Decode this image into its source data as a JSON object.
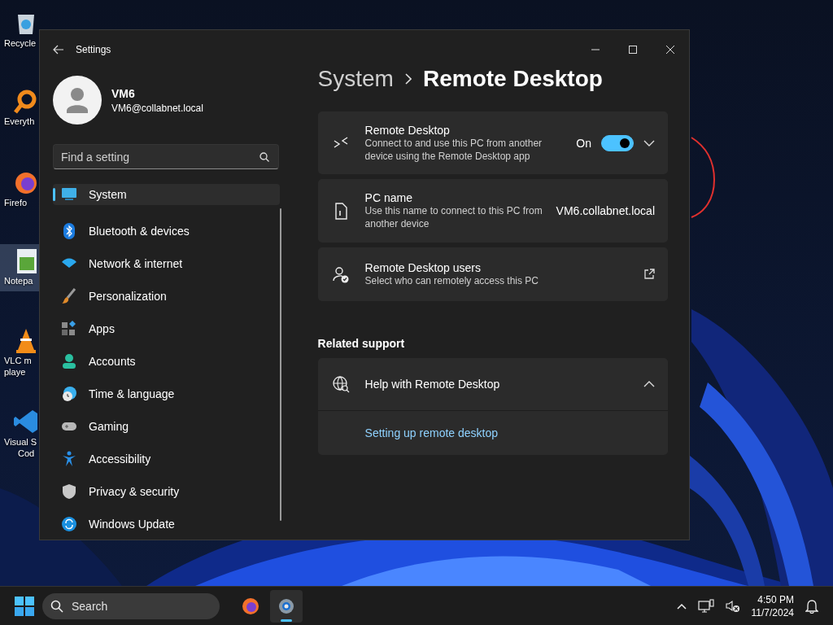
{
  "desktop": {
    "icons": [
      {
        "kind": "recycle",
        "selected": false,
        "lines": [
          "Recycle"
        ]
      },
      {
        "kind": "search",
        "selected": false,
        "lines": [
          "Everyth"
        ]
      },
      {
        "kind": "firefox",
        "selected": false,
        "lines": [
          "Firefo"
        ]
      },
      {
        "kind": "notepad",
        "selected": true,
        "lines": [
          "Notepa"
        ]
      },
      {
        "kind": "vlc",
        "selected": false,
        "lines": [
          "VLC m",
          "playe"
        ]
      },
      {
        "kind": "vscode",
        "selected": false,
        "lines": [
          "Visual S",
          "Cod"
        ]
      }
    ]
  },
  "window": {
    "title": "Settings",
    "profile": {
      "name": "VM6",
      "email": "VM6@collabnet.local"
    },
    "search": {
      "placeholder": "Find a setting"
    },
    "nav": [
      {
        "kind": "system",
        "label": "System",
        "selected": true
      },
      {
        "kind": "bluetooth",
        "label": "Bluetooth & devices",
        "selected": false
      },
      {
        "kind": "network",
        "label": "Network & internet",
        "selected": false
      },
      {
        "kind": "brush",
        "label": "Personalization",
        "selected": false
      },
      {
        "kind": "apps",
        "label": "Apps",
        "selected": false
      },
      {
        "kind": "person",
        "label": "Accounts",
        "selected": false
      },
      {
        "kind": "clock",
        "label": "Time & language",
        "selected": false
      },
      {
        "kind": "gamepad",
        "label": "Gaming",
        "selected": false
      },
      {
        "kind": "figure",
        "label": "Accessibility",
        "selected": false
      },
      {
        "kind": "shield",
        "label": "Privacy & security",
        "selected": false
      },
      {
        "kind": "update",
        "label": "Windows Update",
        "selected": false
      }
    ],
    "breadcrumb": [
      "System",
      "Remote Desktop"
    ],
    "cards": [
      {
        "kind": "toggle",
        "title": "Remote Desktop",
        "description": "Connect to and use this PC from another device using the Remote Desktop app",
        "state_label": "On",
        "on": true,
        "expanded": false
      },
      {
        "kind": "value",
        "title": "PC name",
        "description": "Use this name to connect to this PC from another device",
        "value": "VM6.collabnet.local"
      },
      {
        "kind": "link",
        "title": "Remote Desktop users",
        "description": "Select who can remotely access this PC"
      }
    ],
    "related": {
      "heading": "Related support",
      "items": [
        {
          "title": "Help with Remote Desktop",
          "expanded": true,
          "links": [
            "Setting up remote desktop"
          ]
        }
      ]
    }
  },
  "taskbar": {
    "search_placeholder": "Search",
    "apps": [
      {
        "kind": "firefox",
        "active": false
      },
      {
        "kind": "settings",
        "active": true
      }
    ],
    "time": "4:50 PM",
    "date": "11/7/2024"
  }
}
